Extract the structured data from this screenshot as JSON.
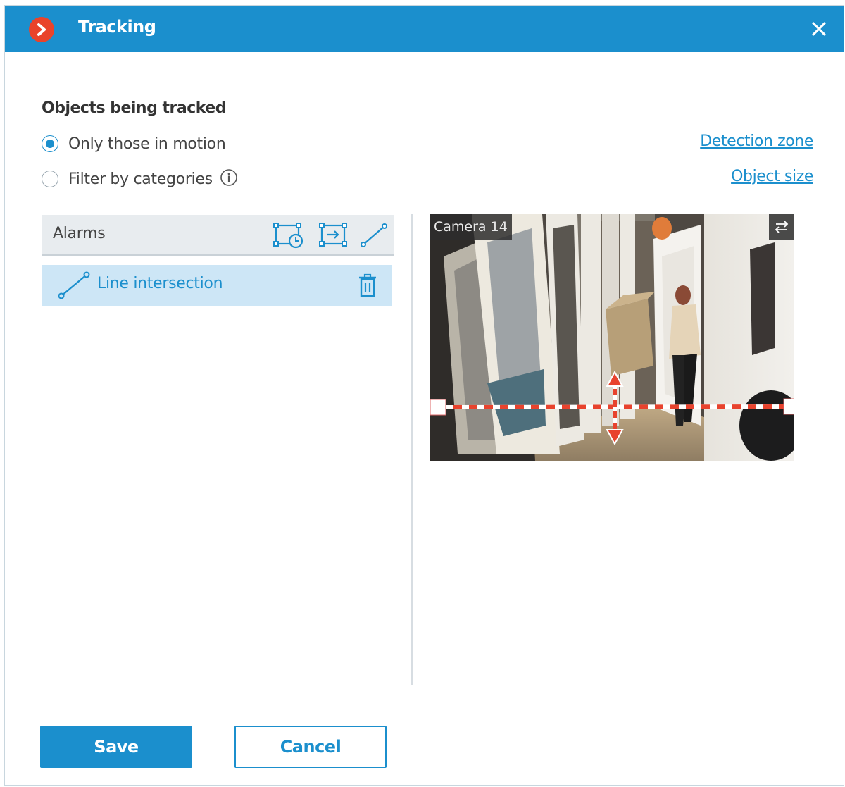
{
  "window": {
    "title": "Tracking"
  },
  "section": {
    "title": "Objects being tracked"
  },
  "options": {
    "motion_label": "Only those in motion",
    "motion_checked": true,
    "categories_label": "Filter by categories",
    "categories_checked": false
  },
  "links": {
    "detection_zone": "Detection zone",
    "object_size": "Object size"
  },
  "alarms": {
    "header": "Alarms",
    "items": [
      {
        "label": "Line intersection",
        "selected": true
      }
    ]
  },
  "camera": {
    "name": "Camera 14"
  },
  "buttons": {
    "save": "Save",
    "cancel": "Cancel"
  },
  "colors": {
    "accent": "#1b8fcd",
    "logo": "#e9432a",
    "line": "#e8432e",
    "selection": "#cde6f6"
  },
  "icons": {
    "logo": "chevron-right-icon",
    "close": "close-icon",
    "info": "info-icon",
    "add_zone_time": "zone-timer-icon",
    "add_zone_enter": "zone-enter-icon",
    "add_line": "line-icon",
    "item_line": "line-icon",
    "delete": "trash-icon",
    "swap": "swap-arrows-icon"
  }
}
